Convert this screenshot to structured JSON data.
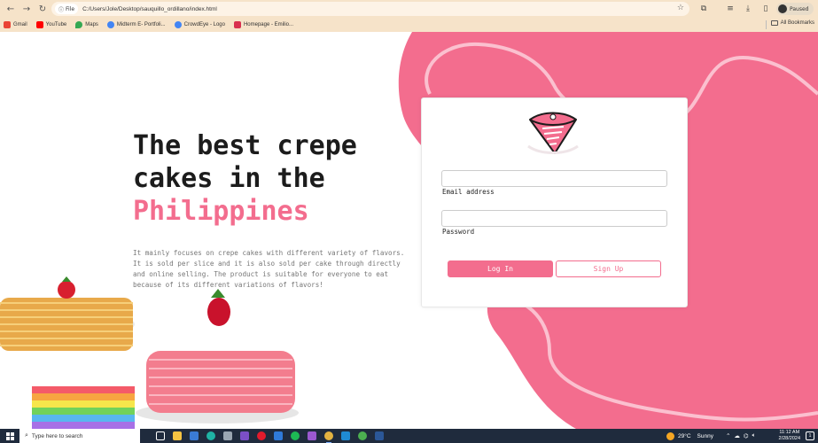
{
  "browser": {
    "back_icon": "←",
    "forward_icon": "→",
    "reload_icon": "↻",
    "file_chip": "File",
    "url": "C:/Users/Jole/Desktop/sauquillo_ordillano/index.html",
    "profile_status": "Paused",
    "bookmarks": [
      {
        "label": "Gmail",
        "color": "#ea4335"
      },
      {
        "label": "YouTube",
        "color": "#ff0000"
      },
      {
        "label": "Maps",
        "color": "#34a853"
      },
      {
        "label": "Midterm E- Portfoli...",
        "color": "#4285f4"
      },
      {
        "label": "CrowdEye - Logo",
        "color": "#4285f4"
      },
      {
        "label": "Homepage - Emilio...",
        "color": "#d9304f"
      }
    ],
    "all_bookmarks": "All Bookmarks"
  },
  "hero": {
    "title_line1": "The best crepe",
    "title_line2": "cakes in the",
    "title_accent": "Philippines",
    "description": "It mainly focuses on crepe cakes with different variety of flavors. It is sold per slice and it is also sold per cake through directly and online selling. The product is suitable for everyone to eat because of its different variations of flavors!"
  },
  "login": {
    "email_label": "Email address",
    "password_label": "Password",
    "login_button": "Log In",
    "signup_button": "Sign Up",
    "logo_icon": "crepe-cake-slice-logo"
  },
  "colors": {
    "accent": "#f36d8e",
    "browser_bar": "#f6e3c9",
    "taskbar": "#1f2b3d"
  },
  "taskbar": {
    "search_placeholder": "Type here to search",
    "weather_temp": "29°C",
    "weather_text": "Sunny",
    "time": "11:12 AM",
    "date": "2/28/2024",
    "notification_count": "1"
  }
}
